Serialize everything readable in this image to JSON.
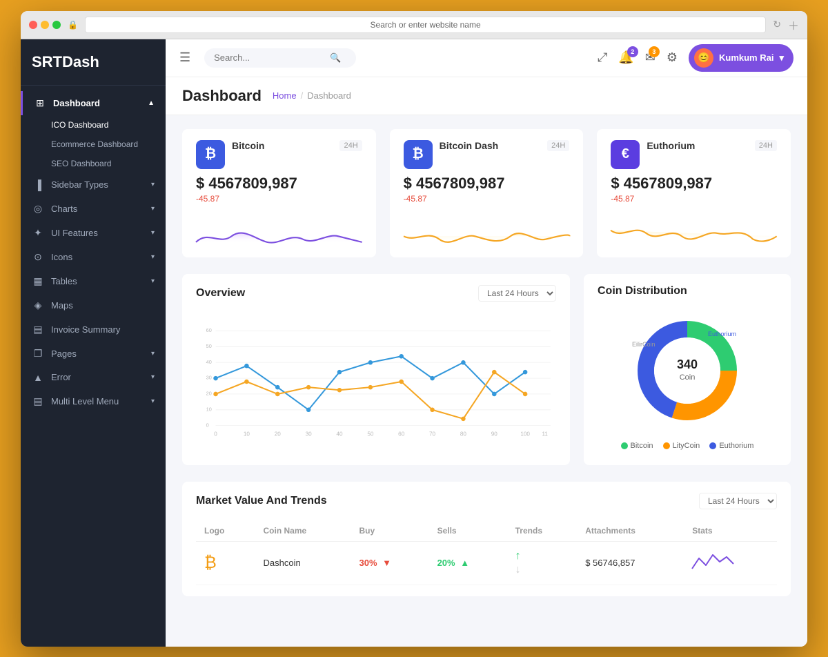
{
  "browser": {
    "url": "Search or enter website name"
  },
  "app": {
    "logo": "SRTDash"
  },
  "sidebar": {
    "items": [
      {
        "id": "dashboard",
        "label": "Dashboard",
        "icon": "⊞",
        "active": true,
        "hasChevron": true
      },
      {
        "id": "ico-dashboard",
        "label": "ICO Dashboard",
        "sub": true,
        "active": true
      },
      {
        "id": "ecommerce-dashboard",
        "label": "Ecommerce Dashboard",
        "sub": true
      },
      {
        "id": "seo-dashboard",
        "label": "SEO Dashboard",
        "sub": true
      },
      {
        "id": "sidebar-types",
        "label": "Sidebar Types",
        "icon": "▐",
        "hasChevron": true
      },
      {
        "id": "charts",
        "label": "Charts",
        "icon": "◎",
        "hasChevron": true
      },
      {
        "id": "ui-features",
        "label": "UI Features",
        "icon": "✦",
        "hasChevron": true
      },
      {
        "id": "icons",
        "label": "Icons",
        "icon": "⊙",
        "hasChevron": true
      },
      {
        "id": "tables",
        "label": "Tables",
        "icon": "▦",
        "hasChevron": true
      },
      {
        "id": "maps",
        "label": "Maps",
        "icon": "◈",
        "hasChevron": false
      },
      {
        "id": "invoice-summary",
        "label": "Invoice Summary",
        "icon": "▤",
        "hasChevron": false
      },
      {
        "id": "pages",
        "label": "Pages",
        "icon": "❐",
        "hasChevron": true
      },
      {
        "id": "error",
        "label": "Error",
        "icon": "▲",
        "hasChevron": true
      },
      {
        "id": "multi-level-menu",
        "label": "Multi Level Menu",
        "icon": "▤",
        "hasChevron": true
      }
    ]
  },
  "topbar": {
    "search_placeholder": "Search...",
    "bell_badge": "2",
    "mail_badge": "3",
    "user_name": "Kumkum Rai"
  },
  "page_header": {
    "title": "Dashboard",
    "breadcrumb_home": "Home",
    "breadcrumb_current": "Dashboard"
  },
  "crypto_cards": [
    {
      "icon": "₿",
      "name": "Bitcoin",
      "period": "24H",
      "value": "$ 4567809,987",
      "change": "-45.87",
      "color": "#3c5ae0"
    },
    {
      "icon": "₿",
      "name": "Bitcoin Dash",
      "period": "24H",
      "value": "$ 4567809,987",
      "change": "-45.87",
      "color": "#3c5ae0"
    },
    {
      "icon": "€",
      "name": "Euthorium",
      "period": "24H",
      "value": "$ 4567809,987",
      "change": "-45.87",
      "color": "#5b3de0"
    }
  ],
  "overview": {
    "title": "Overview",
    "period_label": "Last 24 Hours",
    "y_labels": [
      "60",
      "50",
      "40",
      "30",
      "20",
      "10",
      "0"
    ],
    "x_labels": [
      "0",
      "10",
      "20",
      "30",
      "40",
      "50",
      "60",
      "70",
      "80",
      "90",
      "100",
      "11"
    ]
  },
  "coin_distribution": {
    "title": "Coin Distribution",
    "center_label": "340 Coin",
    "segments": [
      {
        "label": "Bitcoin",
        "color": "#2ecc71",
        "pct": 25
      },
      {
        "label": "LityCoin",
        "color": "#ff9500",
        "pct": 30
      },
      {
        "label": "Euthorium",
        "color": "#3c5ae0",
        "pct": 45
      }
    ],
    "outer_labels": [
      {
        "label": "EilirCoin",
        "side": "left"
      },
      {
        "label": "Euthorium",
        "side": "right"
      }
    ]
  },
  "market": {
    "title": "Market Value And Trends",
    "period_label": "Last 24 Hours",
    "columns": [
      "Logo",
      "Coin Name",
      "Buy",
      "Sells",
      "Trends",
      "Attachments",
      "Stats"
    ],
    "rows": [
      {
        "logo": "₿",
        "coin_name": "Dashcoin",
        "buy": "30%",
        "buy_dir": "down",
        "sells": "20%",
        "sells_dir": "up",
        "trend_up": true,
        "trend_down": true,
        "attachments": "$ 56746,857",
        "stats": "wave"
      }
    ]
  }
}
